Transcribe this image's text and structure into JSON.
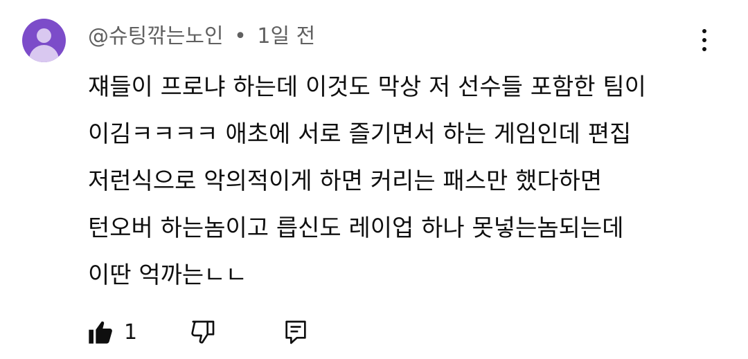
{
  "comment": {
    "author": "@슈팅깎는노인",
    "separator": "•",
    "time": "1일 전",
    "lines": [
      "쟤들이 프로냐 하는데 이것도 막상 저 선수들 포함한 팀이",
      "이김ㅋㅋㅋㅋ 애초에 서로 즐기면서 하는 게임인데 편집",
      "저런식으로 악의적이게 하면 커리는 패스만 했다하면",
      "턴오버 하는놈이고 릅신도 레이업 하나 못넣는놈되는데",
      "이딴 억까는ㄴㄴ"
    ],
    "like_count": "1"
  },
  "icons": {
    "avatar": "default-avatar",
    "more": "more-vertical-icon",
    "like": "thumbs-up-filled-icon",
    "dislike": "thumbs-down-icon",
    "reply": "reply-comment-icon"
  },
  "colors": {
    "avatar_bg": "#7c4cc9",
    "meta_text": "#606060",
    "body_text": "#0f0f0f"
  }
}
